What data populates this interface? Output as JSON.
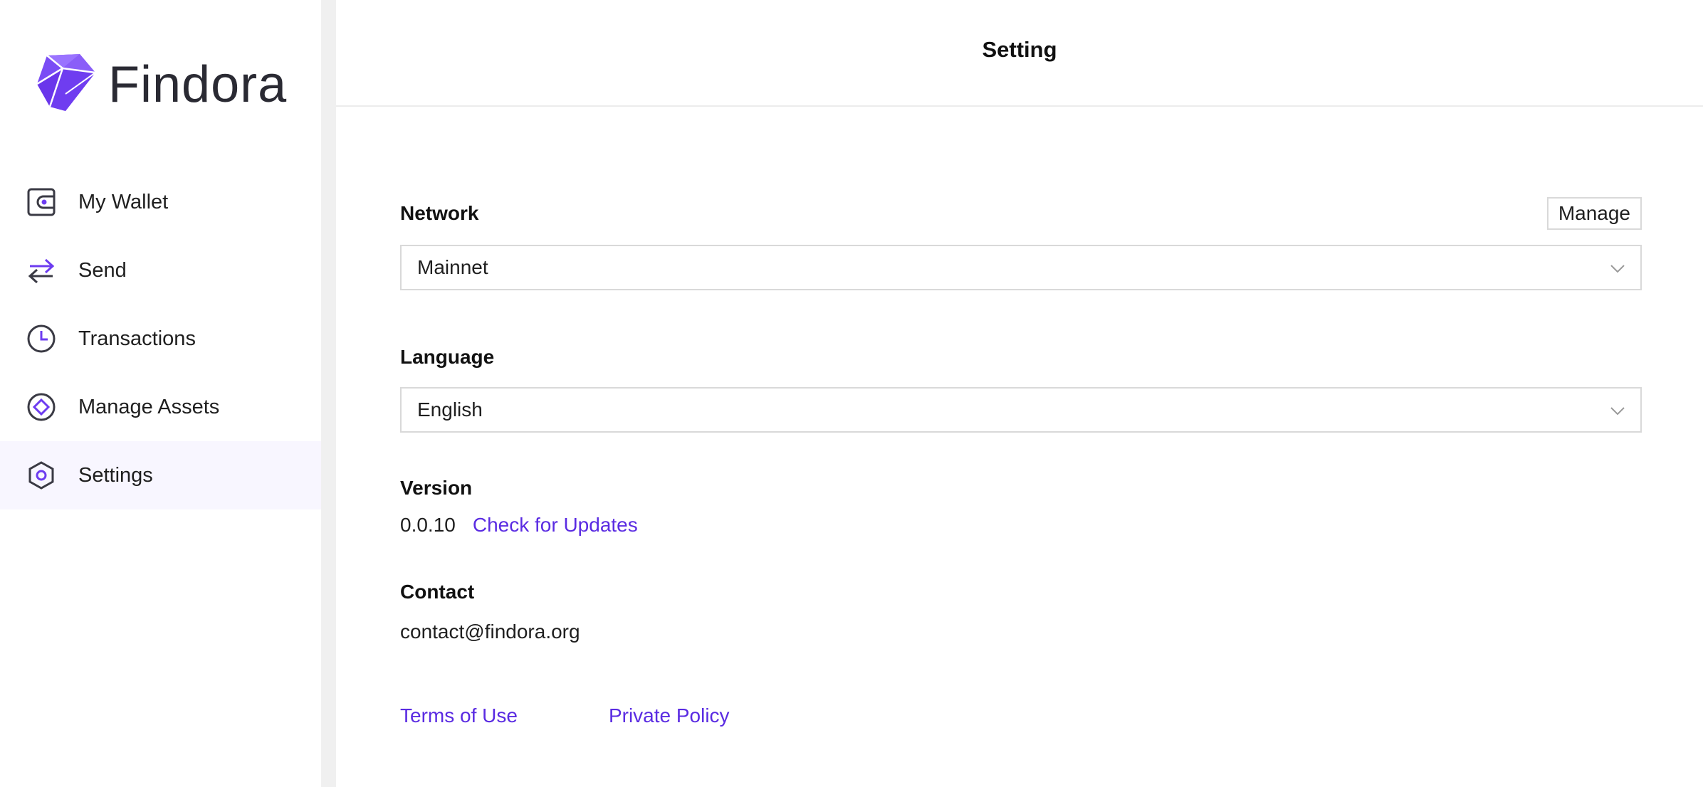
{
  "brand": {
    "name": "Findora",
    "accent_color": "#6d3cf0"
  },
  "sidebar": {
    "items": [
      {
        "label": "My Wallet",
        "icon": "wallet-icon",
        "active": false
      },
      {
        "label": "Send",
        "icon": "transfer-arrows-icon",
        "active": false
      },
      {
        "label": "Transactions",
        "icon": "clock-icon",
        "active": false
      },
      {
        "label": "Manage Assets",
        "icon": "asset-diamond-icon",
        "active": false
      },
      {
        "label": "Settings",
        "icon": "hexagon-settings-icon",
        "active": true
      }
    ]
  },
  "header": {
    "title": "Setting"
  },
  "settings": {
    "network": {
      "label": "Network",
      "manage_label": "Manage",
      "selected": "Mainnet"
    },
    "language": {
      "label": "Language",
      "selected": "English"
    },
    "version": {
      "label": "Version",
      "number": "0.0.10",
      "check_updates_label": "Check for Updates"
    },
    "contact": {
      "label": "Contact",
      "email": "contact@findora.org"
    }
  },
  "footer": {
    "terms_label": "Terms of Use",
    "privacy_label": "Private Policy"
  },
  "colors": {
    "link": "#5a2be2",
    "active_nav_bg": "#f8f6ff",
    "border": "#d9d9d9"
  }
}
